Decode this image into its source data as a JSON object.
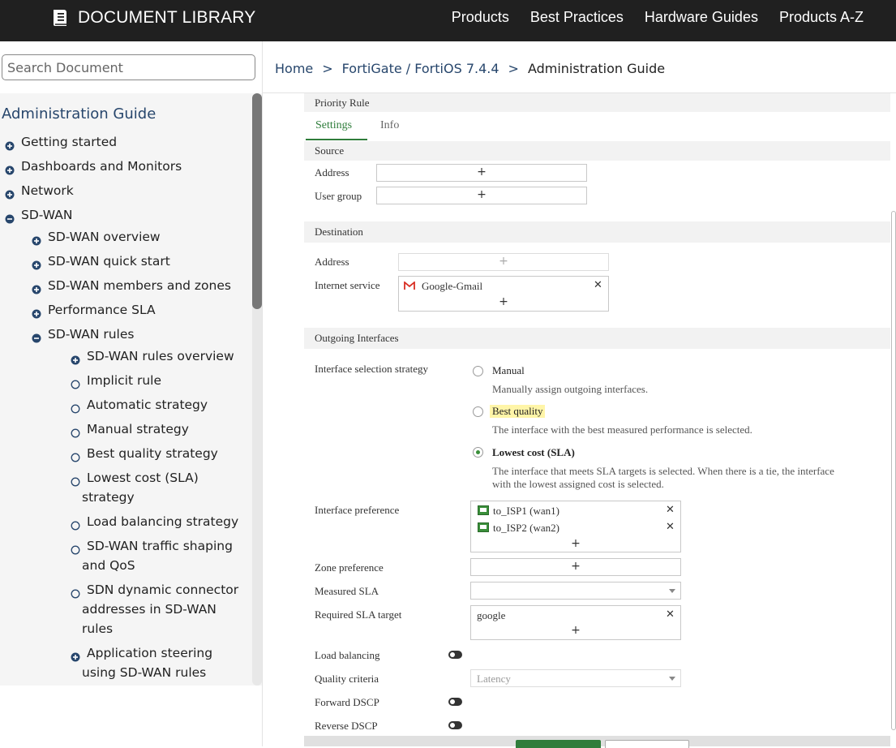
{
  "header": {
    "brand": "DOCUMENT LIBRARY",
    "nav": [
      "Products",
      "Best Practices",
      "Hardware Guides",
      "Products A-Z"
    ]
  },
  "sidebar": {
    "search_placeholder": "Search Document",
    "title": "Administration Guide",
    "items": [
      {
        "label": "Getting started",
        "icon": "plus-circle-icon"
      },
      {
        "label": "Dashboards and Monitors",
        "icon": "plus-circle-icon"
      },
      {
        "label": "Network",
        "icon": "plus-circle-icon"
      },
      {
        "label": "SD-WAN",
        "icon": "minus-circle-icon"
      },
      {
        "label": "SD-WAN overview",
        "icon": "plus-circle-icon"
      },
      {
        "label": "SD-WAN quick start",
        "icon": "plus-circle-icon"
      },
      {
        "label": "SD-WAN members and zones",
        "icon": "plus-circle-icon"
      },
      {
        "label": "Performance SLA",
        "icon": "plus-circle-icon"
      },
      {
        "label": "SD-WAN rules",
        "icon": "minus-circle-icon"
      },
      {
        "label": "SD-WAN rules overview",
        "icon": "plus-circle-icon"
      },
      {
        "label": "Implicit rule",
        "icon": "open-circle-icon"
      },
      {
        "label": "Automatic strategy",
        "icon": "open-circle-icon"
      },
      {
        "label": "Manual strategy",
        "icon": "open-circle-icon"
      },
      {
        "label": "Best quality strategy",
        "icon": "open-circle-icon"
      },
      {
        "label": "Lowest cost (SLA)",
        "label2": "strategy",
        "icon": "open-circle-icon"
      },
      {
        "label": "Load balancing strategy",
        "icon": "open-circle-icon"
      },
      {
        "label": "SD-WAN traffic shaping",
        "label2": "and QoS",
        "icon": "open-circle-icon"
      },
      {
        "label": "SDN dynamic connector",
        "label2": "addresses in SD-WAN",
        "label3": "rules",
        "icon": "open-circle-icon"
      },
      {
        "label": "Application steering",
        "label2": "using SD-WAN rules",
        "icon": "plus-circle-icon"
      }
    ]
  },
  "breadcrumb": {
    "home": "Home",
    "sep": ">",
    "product": "FortiGate / FortiOS 7.4.4",
    "current": "Administration Guide"
  },
  "form": {
    "header": "Priority Rule",
    "tabs": [
      "Settings",
      "Info"
    ],
    "source": {
      "section": "Source",
      "address_label": "Address",
      "user_group_label": "User group"
    },
    "destination": {
      "section": "Destination",
      "address_label": "Address",
      "internet_service_label": "Internet service",
      "internet_service_value": "Google-Gmail"
    },
    "outgoing": {
      "section": "Outgoing Interfaces",
      "strategy_label": "Interface selection strategy",
      "options": [
        {
          "label": "Manual",
          "desc": "Manually assign outgoing interfaces."
        },
        {
          "label": "Best quality",
          "desc": "The interface with the best measured performance is selected."
        },
        {
          "label": "Lowest cost (SLA)",
          "desc": "The interface that meets SLA targets is selected. When there is a tie, the interface",
          "desc2": "with the lowest assigned cost is selected."
        }
      ],
      "selected": "Lowest cost (SLA)",
      "interface_pref_label": "Interface preference",
      "interfaces": [
        "to_ISP1 (wan1)",
        "to_ISP2 (wan2)"
      ],
      "zone_pref_label": "Zone preference",
      "measured_sla_label": "Measured SLA",
      "required_sla_label": "Required SLA target",
      "required_sla_value": "google",
      "load_balancing_label": "Load balancing",
      "quality_criteria_label": "Quality criteria",
      "quality_criteria_value": "Latency",
      "forward_dscp_label": "Forward DSCP",
      "reverse_dscp_label": "Reverse DSCP"
    },
    "plus": "+",
    "x": "✕"
  },
  "colors": {
    "header_bg": "#202020",
    "link": "#27466c",
    "tab_active": "#2f7d3b",
    "highlight": "#fff5a8"
  }
}
